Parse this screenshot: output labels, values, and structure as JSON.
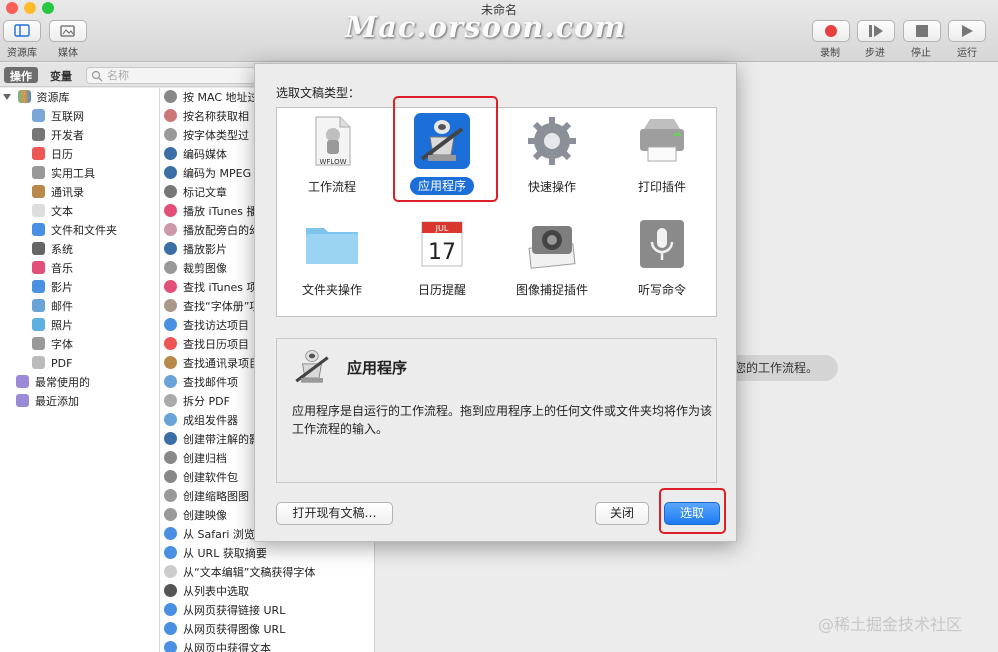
{
  "window": {
    "title": "未命名",
    "watermark_top": "Mac.orsoon.com",
    "watermark_bottom": "@稀土掘金技术社区",
    "colors": {
      "close": "#fc5f57",
      "minimize": "#fdbb2e",
      "zoom": "#28c840",
      "accent": "#1c6ed9",
      "highlight": "#e01e26"
    }
  },
  "toolbar": {
    "library_label": "资源库",
    "media_label": "媒体",
    "record_label": "录制",
    "step_label": "步进",
    "stop_label": "停止",
    "run_label": "运行"
  },
  "tabs": {
    "actions": "操作",
    "variables": "变量",
    "search_placeholder": "名称"
  },
  "library": {
    "root": "资源库",
    "items": [
      "互联网",
      "开发者",
      "日历",
      "实用工具",
      "通讯录",
      "文本",
      "文件和文件夹",
      "系统",
      "音乐",
      "影片",
      "邮件",
      "照片",
      "字体",
      "PDF"
    ],
    "recent": [
      "最常使用的",
      "最近添加"
    ]
  },
  "actions": [
    "按 MAC 地址过",
    "按名称获取相",
    "按字体类型过",
    "编码媒体",
    "编码为 MPEG",
    "标记文章",
    "播放 iTunes 播",
    "播放配旁白的幻",
    "播放影片",
    "裁剪图像",
    "查找 iTunes 项",
    "查找“字体册”项",
    "查找访达项目",
    "查找日历项目",
    "查找通讯录项目",
    "查找邮件项",
    "拆分 PDF",
    "成组发件器",
    "创建带注解的影",
    "创建归档",
    "创建软件包",
    "创建缩略图图",
    "创建映像",
    "从 Safari 浏览",
    "从 URL 获取摘要",
    "从“文本编辑”文稿获得字体",
    "从列表中选取",
    "从网页获得链接 URL",
    "从网页获得图像 URL",
    "从网页中获得文本"
  ],
  "workflow": {
    "hint": "您的工作流程。"
  },
  "sheet": {
    "title": "选取文稿类型：",
    "types": [
      {
        "label": "工作流程",
        "icon": "wflow-document-icon",
        "icon_text": "WFLOW"
      },
      {
        "label": "应用程序",
        "icon": "automator-robot-icon",
        "selected": true
      },
      {
        "label": "快速操作",
        "icon": "gear-icon"
      },
      {
        "label": "打印插件",
        "icon": "printer-icon"
      },
      {
        "label": "文件夹操作",
        "icon": "folder-icon"
      },
      {
        "label": "日历提醒",
        "icon": "calendar-icon",
        "month": "JUL",
        "day": "17"
      },
      {
        "label": "图像捕捉插件",
        "icon": "camera-icon"
      },
      {
        "label": "听写命令",
        "icon": "microphone-icon"
      }
    ],
    "description": {
      "title": "应用程序",
      "body": "应用程序是自运行的工作流程。拖到应用程序上的任何文件或文件夹均将作为该工作流程的输入。"
    },
    "buttons": {
      "open_existing": "打开现有文稿…",
      "close": "关闭",
      "choose": "选取"
    }
  }
}
